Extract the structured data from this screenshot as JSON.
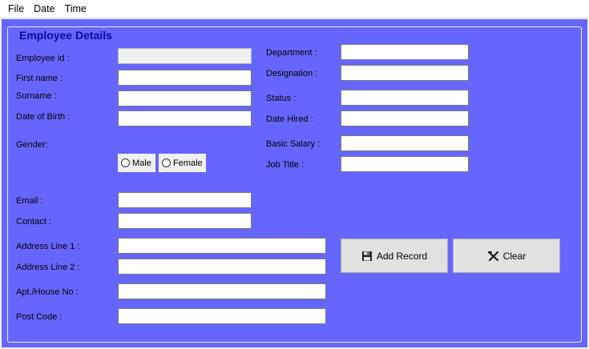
{
  "menu": {
    "items": [
      "File",
      "Date",
      "Time"
    ]
  },
  "group": {
    "title": "Employee Details"
  },
  "labels": {
    "employee_id": "Employee id :",
    "first_name": "First name :",
    "surname": "Surname :",
    "dob": "Date of Birth :",
    "gender": "Gender:",
    "email": "Email :",
    "contact": "Contact :",
    "address1": "Address Line 1 :",
    "address2": "Address Line 2 :",
    "apt": "Apt./House No :",
    "postcode": "Post Code :",
    "department": "Department :",
    "designation": "Designation :",
    "status": "Status :",
    "date_hired": "Date Hired :",
    "basic_salary": "Basic Salary :",
    "job_title": "Job Title :"
  },
  "fields": {
    "employee_id": "",
    "first_name": "",
    "surname": "",
    "dob": "",
    "email": "",
    "contact": "",
    "address1": "",
    "address2": "",
    "apt": "",
    "postcode": "",
    "department": "",
    "designation": "",
    "status": "",
    "date_hired": "",
    "basic_salary": "",
    "job_title": ""
  },
  "gender": {
    "male": "Male",
    "female": "Female",
    "selected": null
  },
  "buttons": {
    "add_record": "Add Record",
    "clear": "Clear"
  },
  "icons": {
    "add_record": "floppy-disk-icon",
    "clear": "x-icon"
  },
  "colors": {
    "panel_bg": "#6666ff",
    "title": "#0a0a9a",
    "button_bg": "#e1e1e1"
  }
}
